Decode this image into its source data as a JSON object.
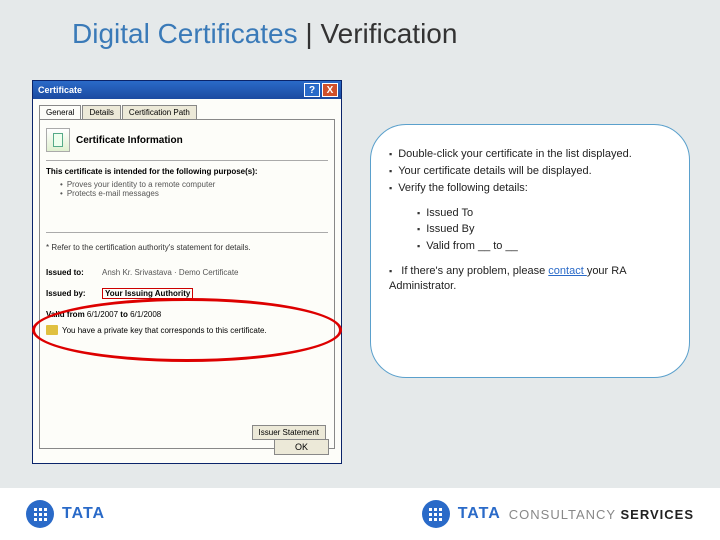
{
  "title": {
    "part1": "Digital Certificates",
    "sep": " | ",
    "part2": "Verification"
  },
  "window": {
    "title": "Certificate",
    "help": "?",
    "close": "X",
    "tabs": {
      "general": "General",
      "details": "Details",
      "path": "Certification Path"
    },
    "cert_info_heading": "Certificate Information",
    "purpose_head": "This certificate is intended for the following purpose(s):",
    "purposes": [
      "Proves your identity to a remote computer",
      "Protects e-mail messages"
    ],
    "refer_note": "* Refer to the certification authority's statement for details.",
    "issued_to_label": "Issued to:",
    "issued_to_value": "Ansh Kr. Srivastava · Demo Certificate",
    "issued_by_label": "Issued by:",
    "issued_by_value": "Your Issuing Authority",
    "valid_from_label": "Valid from",
    "valid_from_value": "6/1/2007",
    "valid_to_label": "to",
    "valid_to_value": "6/1/2008",
    "key_note": "You have a private key that corresponds to this certificate.",
    "issuer_stmt_btn": "Issuer Statement",
    "ok_btn": "OK"
  },
  "callout": {
    "b1": "Double-click your certificate in the list displayed.",
    "b2": "Your certificate details will be displayed.",
    "b3": "Verify the following details:",
    "s1": "Issued To",
    "s2": "Issued By",
    "s3": "Valid from __ to __",
    "b4a": "If there's any problem, please ",
    "b4link": "contact ",
    "b4b": "your RA Administrator."
  },
  "footer": {
    "tata": "TATA",
    "cs1": "CONSULTANCY ",
    "cs2": "SERVICES"
  }
}
